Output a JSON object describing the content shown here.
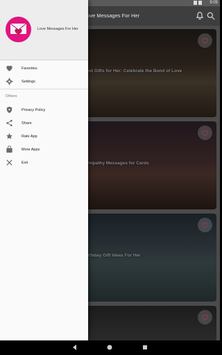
{
  "status_bar": {
    "time": "9:05"
  },
  "app_bar": {
    "title": "Love Messages For Her"
  },
  "cards": [
    {
      "title": "Best Gifts for Her: Celebrate the Bond of Love"
    },
    {
      "title": "Sympathy Messages for Cards"
    },
    {
      "title": "Birthday Gift Ideas For Her"
    },
    {
      "title": ""
    }
  ],
  "drawer": {
    "app_name": "Love Messages For Her",
    "logo_text": "Love Messages for Her",
    "items": [
      {
        "label": "Favorites",
        "icon": "heart-icon"
      },
      {
        "label": "Settings",
        "icon": "gear-icon"
      }
    ],
    "section_label": "Others",
    "other_items": [
      {
        "label": "Privacy Policy",
        "icon": "shield-icon"
      },
      {
        "label": "Share",
        "icon": "share-icon"
      },
      {
        "label": "Rate App",
        "icon": "star-icon"
      },
      {
        "label": "More Apps",
        "icon": "bag-icon"
      },
      {
        "label": "Exit",
        "icon": "close-icon"
      }
    ]
  },
  "colors": {
    "logo": "#e0157f",
    "drawer_bg": "#fafafa"
  }
}
